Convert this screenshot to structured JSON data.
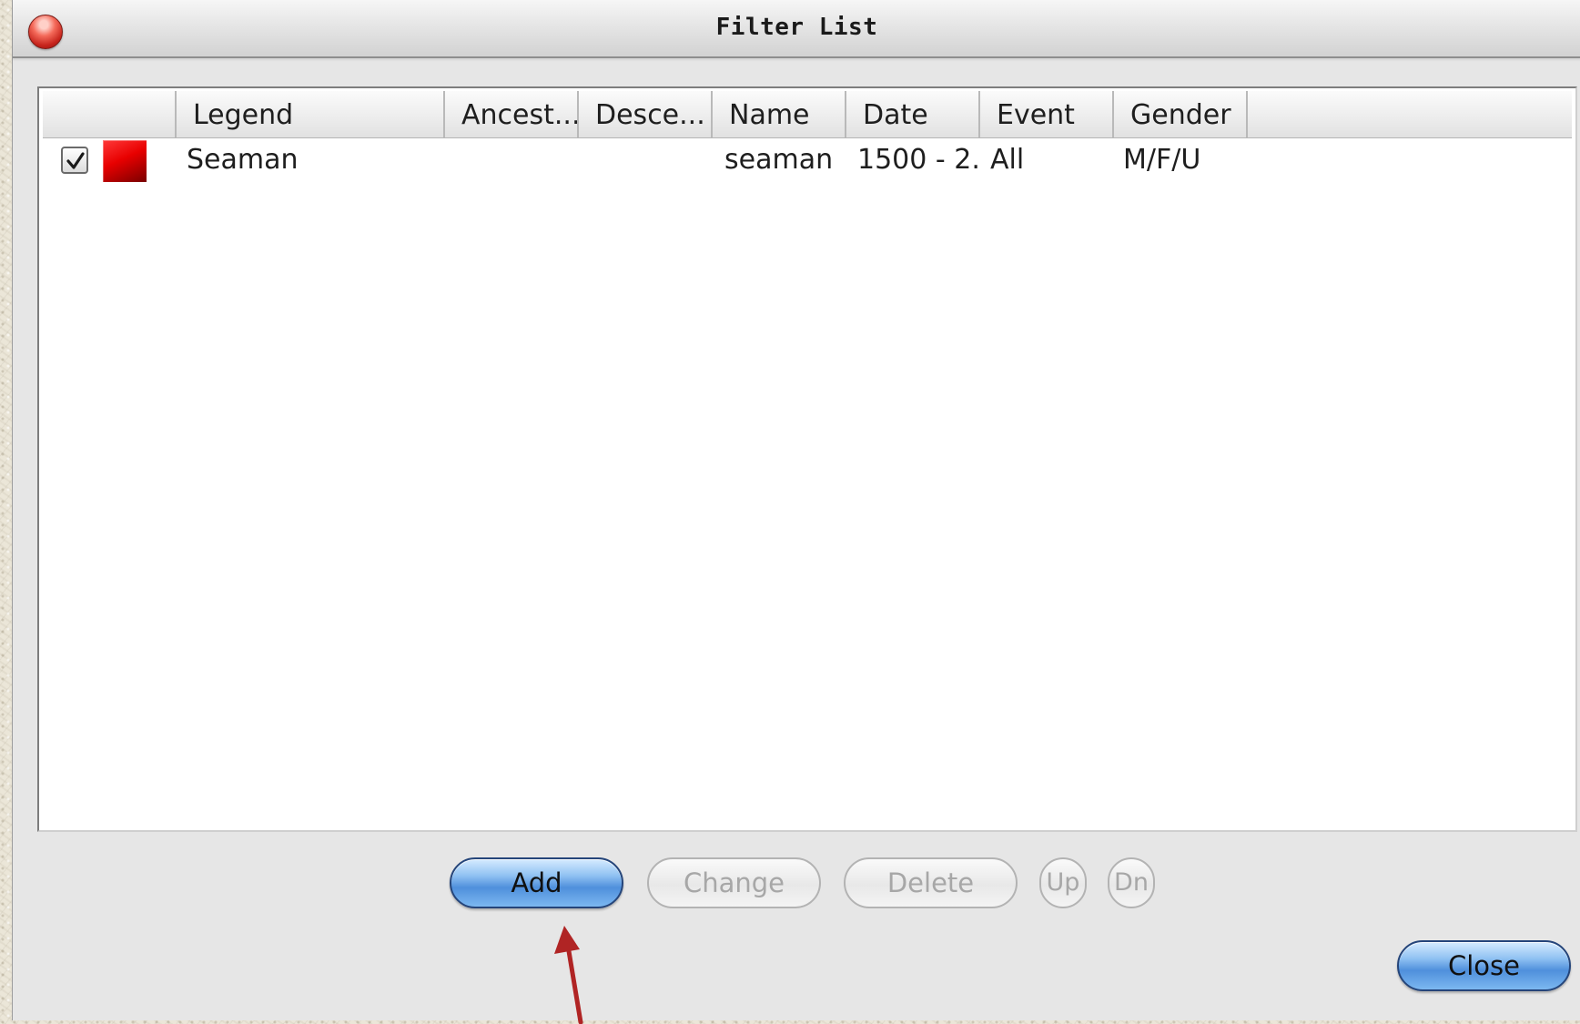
{
  "window": {
    "title": "Filter List"
  },
  "listview": {
    "columns": [
      "",
      "Legend",
      "Ancest...",
      "Desce...",
      "Name",
      "Date",
      "Event",
      "Gender",
      ""
    ],
    "rows": [
      {
        "checked": true,
        "color": "#e00000",
        "legend": "Seaman",
        "ancestors": "",
        "descendants": "",
        "name": "seaman",
        "date": "1500 - 2...",
        "event": "All",
        "gender": "M/F/U"
      }
    ]
  },
  "buttons": {
    "add": "Add",
    "change": "Change",
    "delete": "Delete",
    "up": "Up",
    "down": "Dn",
    "close": "Close"
  },
  "colors": {
    "arrow": "#b02424",
    "primary_button": "#4f8fdc"
  }
}
